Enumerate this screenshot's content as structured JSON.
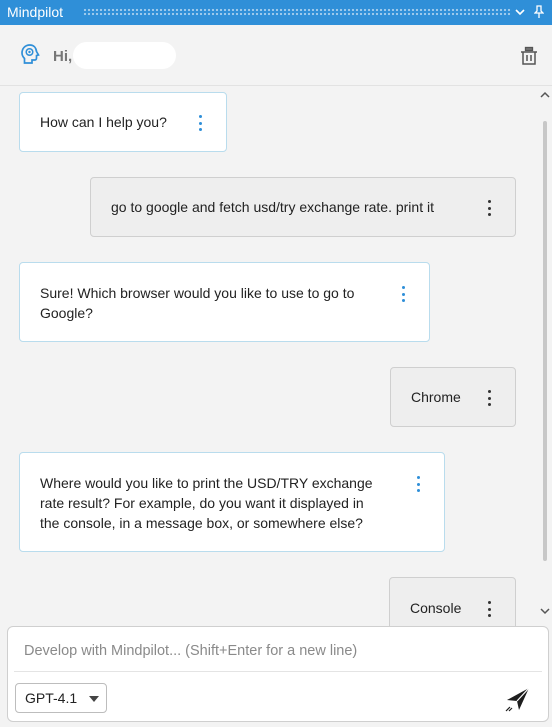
{
  "window": {
    "title": "Mindpilot"
  },
  "header": {
    "greeting": "Hi,"
  },
  "messages": [
    {
      "role": "assistant",
      "text": "How can I help you?"
    },
    {
      "role": "user",
      "text": "go to google and fetch usd/try exchange rate. print it"
    },
    {
      "role": "assistant",
      "line1": "Sure! Which browser would you like to use to go to",
      "line2": "Google?"
    },
    {
      "role": "user",
      "text": "Chrome"
    },
    {
      "role": "assistant",
      "line1": "Where would you like to print the USD/TRY exchange",
      "line2": "rate result? For example, do you want it displayed in",
      "line3": "the console, in a message box, or somewhere else?"
    },
    {
      "role": "user",
      "text": "Console"
    }
  ],
  "input": {
    "placeholder": "Develop with Mindpilot... (Shift+Enter for a new line)"
  },
  "model": {
    "selected": "GPT-4.1"
  },
  "icons": {
    "brand": "brain-head-icon",
    "clear": "trash-icon",
    "menu": "more-vertical-icon",
    "send": "send-icon"
  },
  "colors": {
    "accent": "#2f8fd8",
    "bot_border": "#b9dced"
  }
}
